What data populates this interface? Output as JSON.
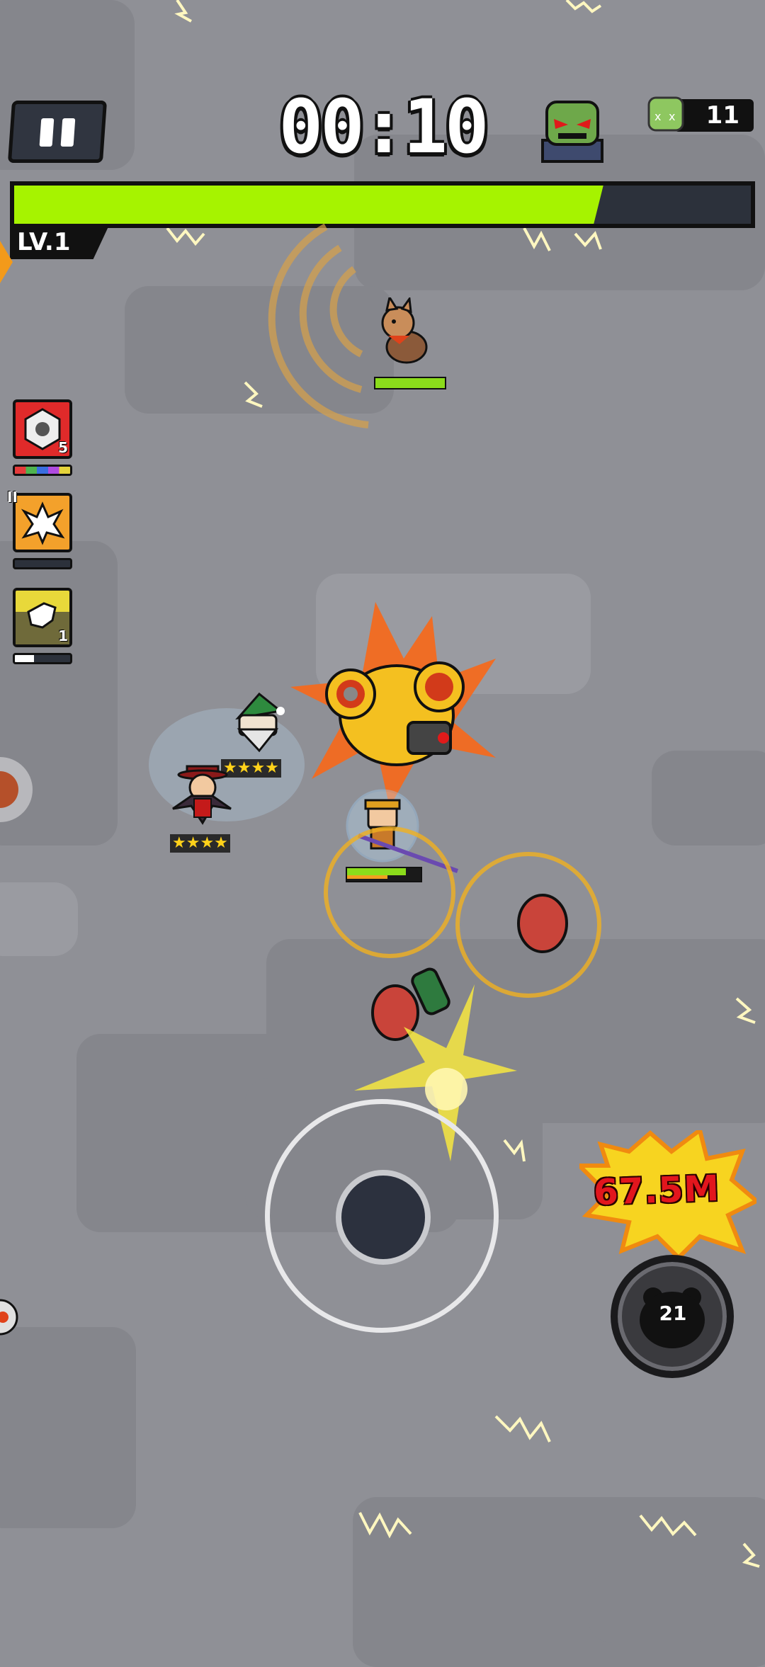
{
  "hud": {
    "timer": "00:10",
    "kill_count": "11",
    "level_label": "LV.1",
    "xp_fraction": 0.78
  },
  "skills": [
    {
      "name": "shield-drone-skill",
      "level": "5",
      "color": "#e02a2a",
      "progress": 1.0
    },
    {
      "name": "explosion-skill",
      "rank": "II",
      "color": "#f3a12b",
      "progress": 0.0
    },
    {
      "name": "fist-skill",
      "level": "1",
      "color": "#e8d83a",
      "progress": 0.35
    }
  ],
  "heroes": [
    {
      "name": "elf-hero",
      "stars": "★★★★"
    },
    {
      "name": "vampire-hero",
      "stars": "★★★★"
    }
  ],
  "player": {
    "hp_fraction": 0.8,
    "energy_fraction": 0.55
  },
  "enemy": {
    "name": "dog-enemy",
    "hp_fraction": 1.0
  },
  "damage_popup": "67.5M",
  "ability": {
    "cooldown": "21"
  },
  "colors": {
    "xp": "#a6f300",
    "hp": "#8bdc1b",
    "damage_text": "#e2161d"
  }
}
